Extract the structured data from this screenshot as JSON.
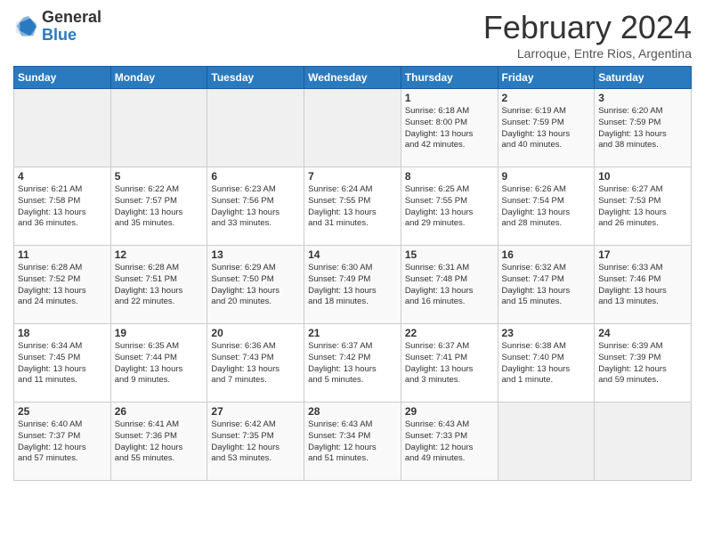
{
  "header": {
    "logo_general": "General",
    "logo_blue": "Blue",
    "title": "February 2024",
    "subtitle": "Larroque, Entre Rios, Argentina"
  },
  "weekdays": [
    "Sunday",
    "Monday",
    "Tuesday",
    "Wednesday",
    "Thursday",
    "Friday",
    "Saturday"
  ],
  "weeks": [
    [
      {
        "day": "",
        "info": ""
      },
      {
        "day": "",
        "info": ""
      },
      {
        "day": "",
        "info": ""
      },
      {
        "day": "",
        "info": ""
      },
      {
        "day": "1",
        "info": "Sunrise: 6:18 AM\nSunset: 8:00 PM\nDaylight: 13 hours\nand 42 minutes."
      },
      {
        "day": "2",
        "info": "Sunrise: 6:19 AM\nSunset: 7:59 PM\nDaylight: 13 hours\nand 40 minutes."
      },
      {
        "day": "3",
        "info": "Sunrise: 6:20 AM\nSunset: 7:59 PM\nDaylight: 13 hours\nand 38 minutes."
      }
    ],
    [
      {
        "day": "4",
        "info": "Sunrise: 6:21 AM\nSunset: 7:58 PM\nDaylight: 13 hours\nand 36 minutes."
      },
      {
        "day": "5",
        "info": "Sunrise: 6:22 AM\nSunset: 7:57 PM\nDaylight: 13 hours\nand 35 minutes."
      },
      {
        "day": "6",
        "info": "Sunrise: 6:23 AM\nSunset: 7:56 PM\nDaylight: 13 hours\nand 33 minutes."
      },
      {
        "day": "7",
        "info": "Sunrise: 6:24 AM\nSunset: 7:55 PM\nDaylight: 13 hours\nand 31 minutes."
      },
      {
        "day": "8",
        "info": "Sunrise: 6:25 AM\nSunset: 7:55 PM\nDaylight: 13 hours\nand 29 minutes."
      },
      {
        "day": "9",
        "info": "Sunrise: 6:26 AM\nSunset: 7:54 PM\nDaylight: 13 hours\nand 28 minutes."
      },
      {
        "day": "10",
        "info": "Sunrise: 6:27 AM\nSunset: 7:53 PM\nDaylight: 13 hours\nand 26 minutes."
      }
    ],
    [
      {
        "day": "11",
        "info": "Sunrise: 6:28 AM\nSunset: 7:52 PM\nDaylight: 13 hours\nand 24 minutes."
      },
      {
        "day": "12",
        "info": "Sunrise: 6:28 AM\nSunset: 7:51 PM\nDaylight: 13 hours\nand 22 minutes."
      },
      {
        "day": "13",
        "info": "Sunrise: 6:29 AM\nSunset: 7:50 PM\nDaylight: 13 hours\nand 20 minutes."
      },
      {
        "day": "14",
        "info": "Sunrise: 6:30 AM\nSunset: 7:49 PM\nDaylight: 13 hours\nand 18 minutes."
      },
      {
        "day": "15",
        "info": "Sunrise: 6:31 AM\nSunset: 7:48 PM\nDaylight: 13 hours\nand 16 minutes."
      },
      {
        "day": "16",
        "info": "Sunrise: 6:32 AM\nSunset: 7:47 PM\nDaylight: 13 hours\nand 15 minutes."
      },
      {
        "day": "17",
        "info": "Sunrise: 6:33 AM\nSunset: 7:46 PM\nDaylight: 13 hours\nand 13 minutes."
      }
    ],
    [
      {
        "day": "18",
        "info": "Sunrise: 6:34 AM\nSunset: 7:45 PM\nDaylight: 13 hours\nand 11 minutes."
      },
      {
        "day": "19",
        "info": "Sunrise: 6:35 AM\nSunset: 7:44 PM\nDaylight: 13 hours\nand 9 minutes."
      },
      {
        "day": "20",
        "info": "Sunrise: 6:36 AM\nSunset: 7:43 PM\nDaylight: 13 hours\nand 7 minutes."
      },
      {
        "day": "21",
        "info": "Sunrise: 6:37 AM\nSunset: 7:42 PM\nDaylight: 13 hours\nand 5 minutes."
      },
      {
        "day": "22",
        "info": "Sunrise: 6:37 AM\nSunset: 7:41 PM\nDaylight: 13 hours\nand 3 minutes."
      },
      {
        "day": "23",
        "info": "Sunrise: 6:38 AM\nSunset: 7:40 PM\nDaylight: 13 hours\nand 1 minute."
      },
      {
        "day": "24",
        "info": "Sunrise: 6:39 AM\nSunset: 7:39 PM\nDaylight: 12 hours\nand 59 minutes."
      }
    ],
    [
      {
        "day": "25",
        "info": "Sunrise: 6:40 AM\nSunset: 7:37 PM\nDaylight: 12 hours\nand 57 minutes."
      },
      {
        "day": "26",
        "info": "Sunrise: 6:41 AM\nSunset: 7:36 PM\nDaylight: 12 hours\nand 55 minutes."
      },
      {
        "day": "27",
        "info": "Sunrise: 6:42 AM\nSunset: 7:35 PM\nDaylight: 12 hours\nand 53 minutes."
      },
      {
        "day": "28",
        "info": "Sunrise: 6:43 AM\nSunset: 7:34 PM\nDaylight: 12 hours\nand 51 minutes."
      },
      {
        "day": "29",
        "info": "Sunrise: 6:43 AM\nSunset: 7:33 PM\nDaylight: 12 hours\nand 49 minutes."
      },
      {
        "day": "",
        "info": ""
      },
      {
        "day": "",
        "info": ""
      }
    ]
  ]
}
